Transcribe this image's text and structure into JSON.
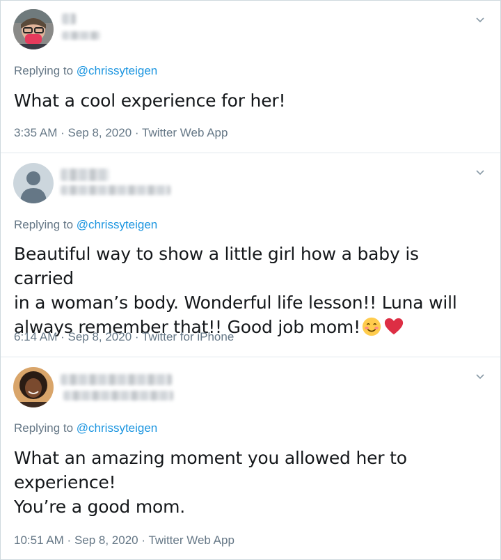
{
  "tweets": [
    {
      "replying_label": "Replying to",
      "reply_handle": "@chrissyteigen",
      "text_lines": [
        "What a cool experience for her!"
      ],
      "time": "3:35 AM",
      "date": "Sep 8, 2020",
      "source": "Twitter Web App"
    },
    {
      "replying_label": "Replying to",
      "reply_handle": "@chrissyteigen",
      "text_lines": [
        "Beautiful way to show a little girl how a baby is carried",
        "in a woman’s body. Wonderful life lesson!! Luna will",
        "always remember that!! Good job mom!"
      ],
      "emojis": [
        "smiling-face-icon",
        "red-heart-icon"
      ],
      "time": "6:14 AM",
      "date": "Sep 8, 2020",
      "source": "Twitter for iPhone"
    },
    {
      "replying_label": "Replying to",
      "reply_handle": "@chrissyteigen",
      "text_lines": [
        "What an amazing moment you allowed her to",
        "experience!",
        "You’re a good mom."
      ],
      "time": "10:51 AM",
      "date": "Sep 8, 2020",
      "source": "Twitter Web App"
    }
  ],
  "separator": " · ",
  "colors": {
    "link": "#1b95e0",
    "meta": "#657786",
    "text": "#14171a",
    "heart": "#e0245e"
  }
}
